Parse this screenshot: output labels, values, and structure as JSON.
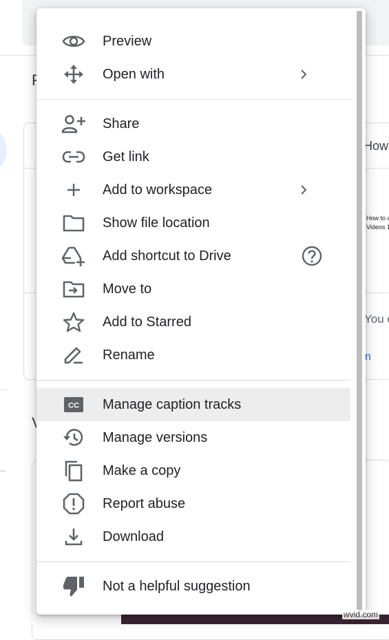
{
  "background": {
    "card_title_partial": "How",
    "heading_partial": "F",
    "section_partial": "V",
    "thumb_text": [
      "How to a",
      "Videos 1"
    ],
    "card_text_partial": "You e",
    "card_link_partial": "n"
  },
  "menu": {
    "sections": [
      [
        {
          "name": "preview",
          "label": "Preview",
          "icon": "eye-icon"
        },
        {
          "name": "open-with",
          "label": "Open with",
          "icon": "move-arrows-icon",
          "submenu": true
        }
      ],
      [
        {
          "name": "share",
          "label": "Share",
          "icon": "add-person-icon"
        },
        {
          "name": "get-link",
          "label": "Get link",
          "icon": "link-icon"
        },
        {
          "name": "add-to-workspace",
          "label": "Add to workspace",
          "icon": "plus-icon",
          "submenu": true
        },
        {
          "name": "show-file-location",
          "label": "Show file location",
          "icon": "folder-icon"
        },
        {
          "name": "add-shortcut",
          "label": "Add shortcut to Drive",
          "icon": "drive-shortcut-icon",
          "help": true
        },
        {
          "name": "move-to",
          "label": "Move to",
          "icon": "move-folder-icon"
        },
        {
          "name": "add-to-starred",
          "label": "Add to Starred",
          "icon": "star-icon"
        },
        {
          "name": "rename",
          "label": "Rename",
          "icon": "pencil-icon"
        }
      ],
      [
        {
          "name": "manage-caption-tracks",
          "label": "Manage caption tracks",
          "icon": "closed-caption-icon",
          "highlighted": true
        },
        {
          "name": "manage-versions",
          "label": "Manage versions",
          "icon": "history-icon"
        },
        {
          "name": "make-a-copy",
          "label": "Make a copy",
          "icon": "copy-icon"
        },
        {
          "name": "report-abuse",
          "label": "Report abuse",
          "icon": "report-icon"
        },
        {
          "name": "download",
          "label": "Download",
          "icon": "download-icon"
        }
      ],
      [
        {
          "name": "not-helpful",
          "label": "Not a helpful suggestion",
          "icon": "thumb-down-icon"
        }
      ]
    ]
  },
  "watermark": "wvid.com",
  "colors": {
    "icon": "#5f6368",
    "text": "#202124",
    "highlight": "#ededed",
    "divider": "#dadce0"
  }
}
